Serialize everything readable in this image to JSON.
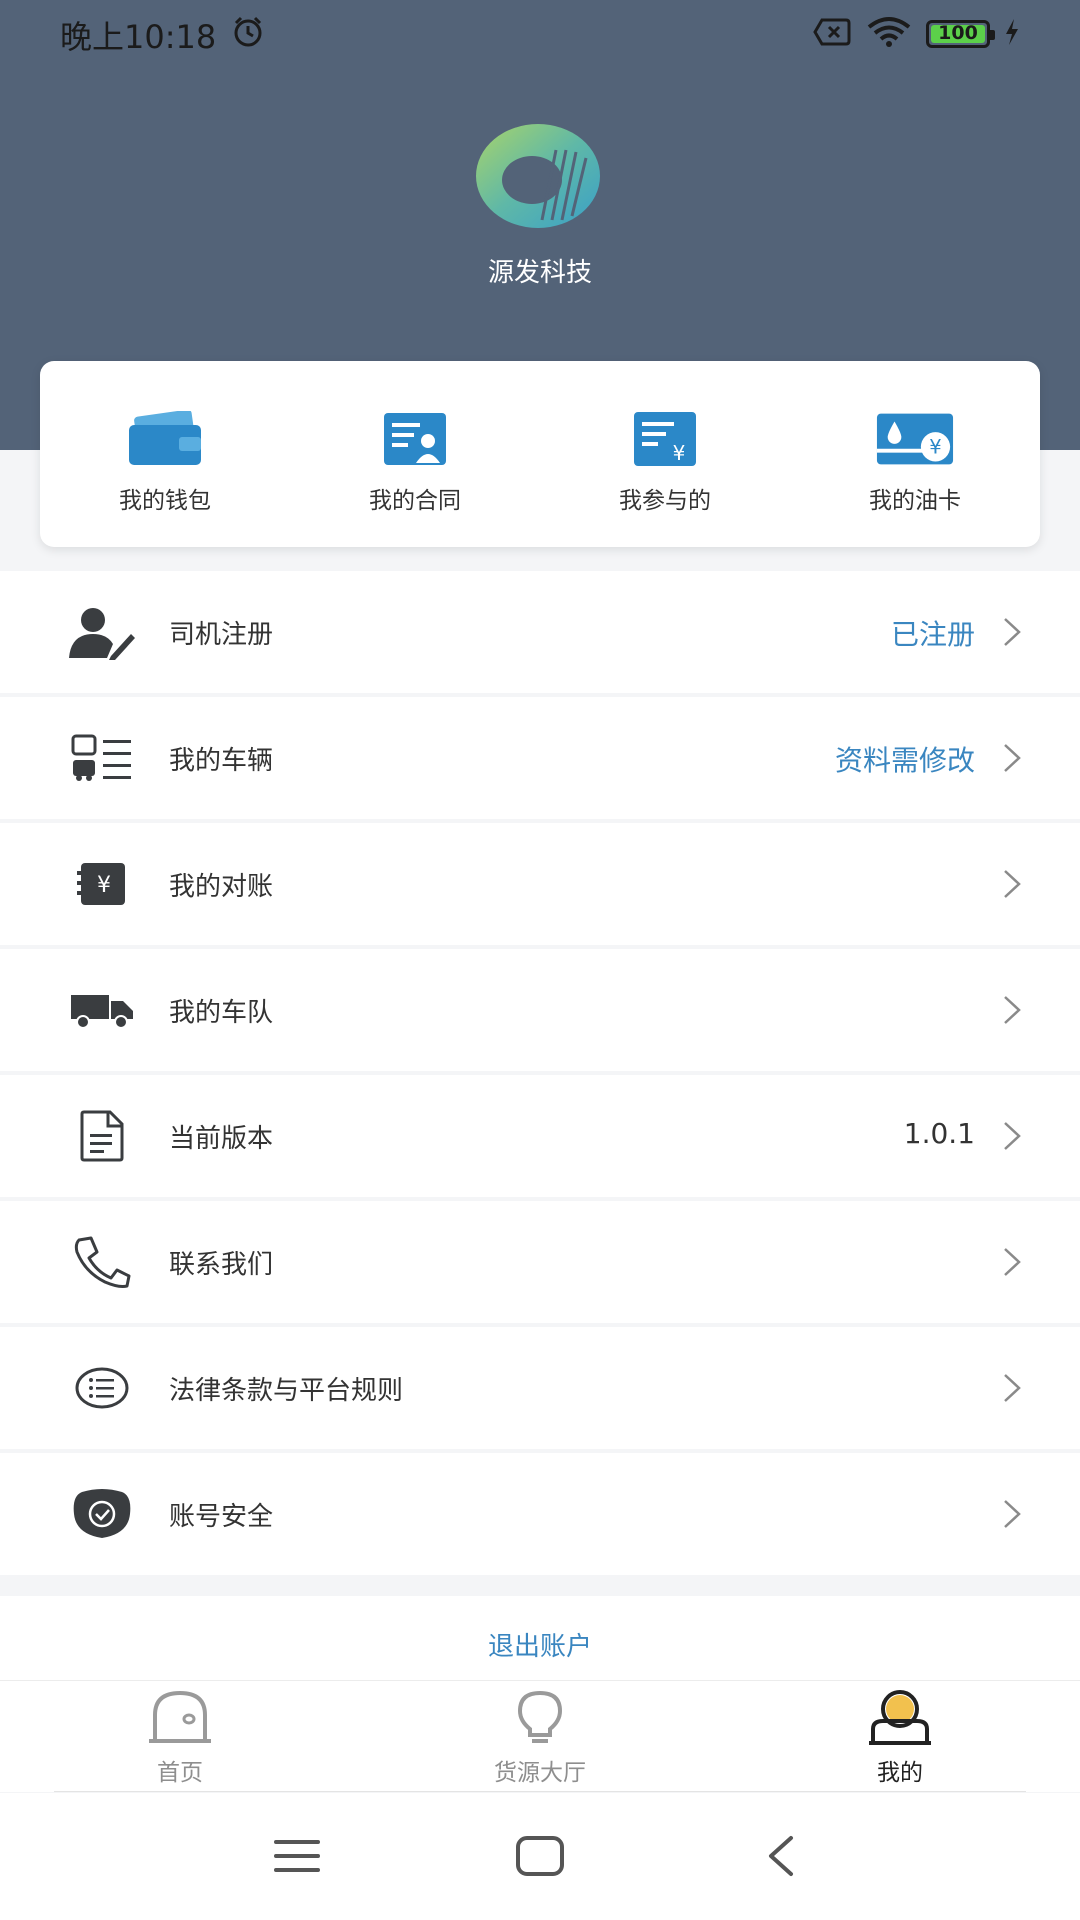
{
  "status_bar": {
    "time": "晚上10:18",
    "battery": "100",
    "battery_level": 1.0,
    "icons": [
      "alarm-icon",
      "sim-off-icon",
      "wifi-icon",
      "battery-icon",
      "charging-icon"
    ]
  },
  "header": {
    "brand_name": "源发科技",
    "background_color": "#536378"
  },
  "quick_actions": [
    {
      "label": "我的钱包",
      "icon": "wallet-icon"
    },
    {
      "label": "我的合同",
      "icon": "contract-icon"
    },
    {
      "label": "我参与的",
      "icon": "participation-icon"
    },
    {
      "label": "我的油卡",
      "icon": "fuel-card-icon"
    }
  ],
  "menu": [
    {
      "label": "司机注册",
      "value": "已注册",
      "icon": "driver-register-icon"
    },
    {
      "label": "我的车辆",
      "value": "资料需修改",
      "icon": "vehicle-list-icon"
    },
    {
      "label": "我的对账",
      "value": "",
      "icon": "reconciliation-icon"
    },
    {
      "label": "我的车队",
      "value": "",
      "icon": "truck-icon"
    },
    {
      "label": "当前版本",
      "value": "1.0.1",
      "icon": "document-icon"
    },
    {
      "label": "联系我们",
      "value": "",
      "icon": "phone-icon"
    },
    {
      "label": "法律条款与平台规则",
      "value": "",
      "icon": "list-icon"
    },
    {
      "label": "账号安全",
      "value": "",
      "icon": "shield-check-icon"
    }
  ],
  "logout": {
    "label": "退出账户"
  },
  "tabbar": {
    "tabs": [
      {
        "label": "首页",
        "icon": "home-icon",
        "active": false
      },
      {
        "label": "货源大厅",
        "icon": "bulb-icon",
        "active": false
      },
      {
        "label": "我的",
        "icon": "user-icon",
        "active": true
      }
    ]
  },
  "colors": {
    "accent": "#3a86c0",
    "icon_blue": "#2b88c8",
    "icon_dark": "#3a3d40",
    "active_tab_yellow": "#f2c14e"
  },
  "navbar": {
    "buttons": [
      "menu-icon",
      "home-square-icon",
      "back-icon"
    ]
  }
}
